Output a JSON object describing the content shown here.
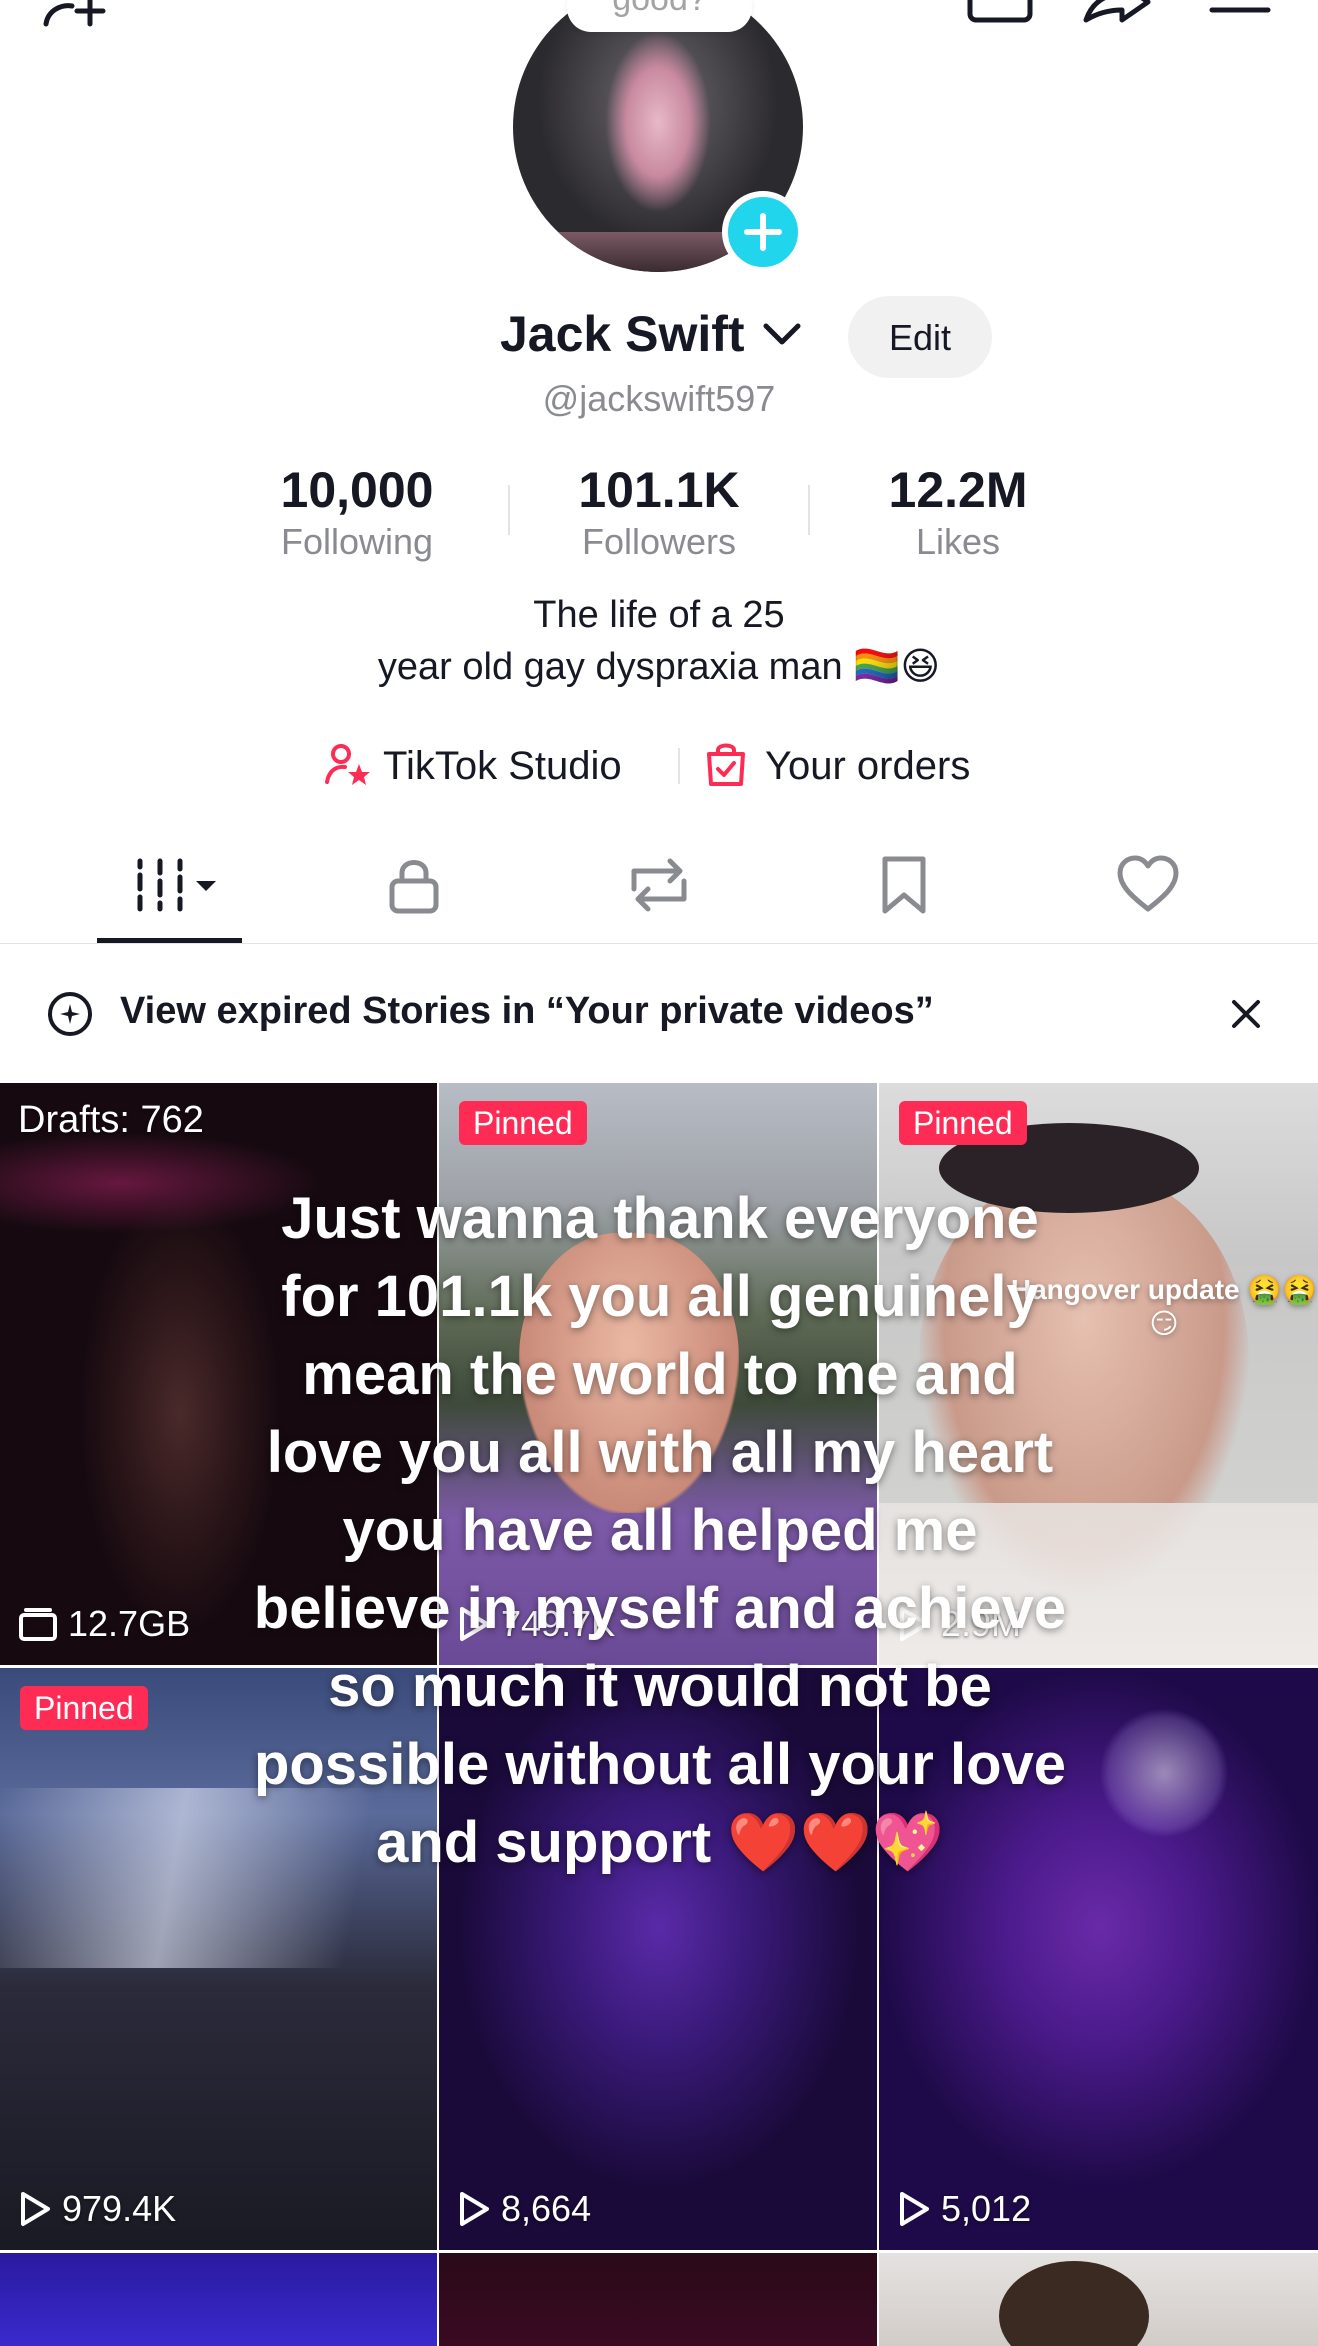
{
  "header": {
    "avatar_bubble": "good?",
    "display_name": "Jack Swift",
    "edit_label": "Edit",
    "handle": "@jackswift597"
  },
  "stats": [
    {
      "value": "10,000",
      "label": "Following"
    },
    {
      "value": "101.1K",
      "label": "Followers"
    },
    {
      "value": "12.2M",
      "label": "Likes"
    }
  ],
  "bio": {
    "line1": "The life of  a  25",
    "line2": "year old gay dyspraxia man 🏳️‍🌈😆"
  },
  "links": {
    "studio": "TikTok Studio",
    "orders": "Your orders"
  },
  "stories_banner": {
    "text": "View expired Stories in “Your private videos”"
  },
  "grid": {
    "drafts_label": "Drafts: 762",
    "drafts_size": "12.7GB",
    "pinned_label": "Pinned",
    "views": [
      "749.7K",
      "2.9M",
      "979.4K",
      "8,664",
      "5,012"
    ],
    "tile3_caption": "Hangover update 🤮🤮\n😏"
  },
  "overlay_caption": "Just wanna thank everyone\nfor 101.1k you all genuinely\nmean the world to me and\nlove you all with all my heart\nyou have all helped me\nbelieve in myself and achieve\nso much it would not be\npossible without all your love\nand support ❤️❤️💖",
  "colors": {
    "accent_red": "#fe2c55",
    "accent_cyan": "#20d5ec",
    "text_primary": "#161823",
    "text_secondary": "#8a8b91"
  },
  "icons": [
    "add-friend-icon",
    "calendar-star-icon",
    "share-icon",
    "menu-icon",
    "plus-icon",
    "chevron-down-icon",
    "studio-icon",
    "shopping-bag-icon",
    "grid-icon",
    "lock-icon",
    "repost-icon",
    "bookmark-icon",
    "heart-icon",
    "story-plus-icon",
    "close-icon",
    "play-icon",
    "folder-icon"
  ]
}
